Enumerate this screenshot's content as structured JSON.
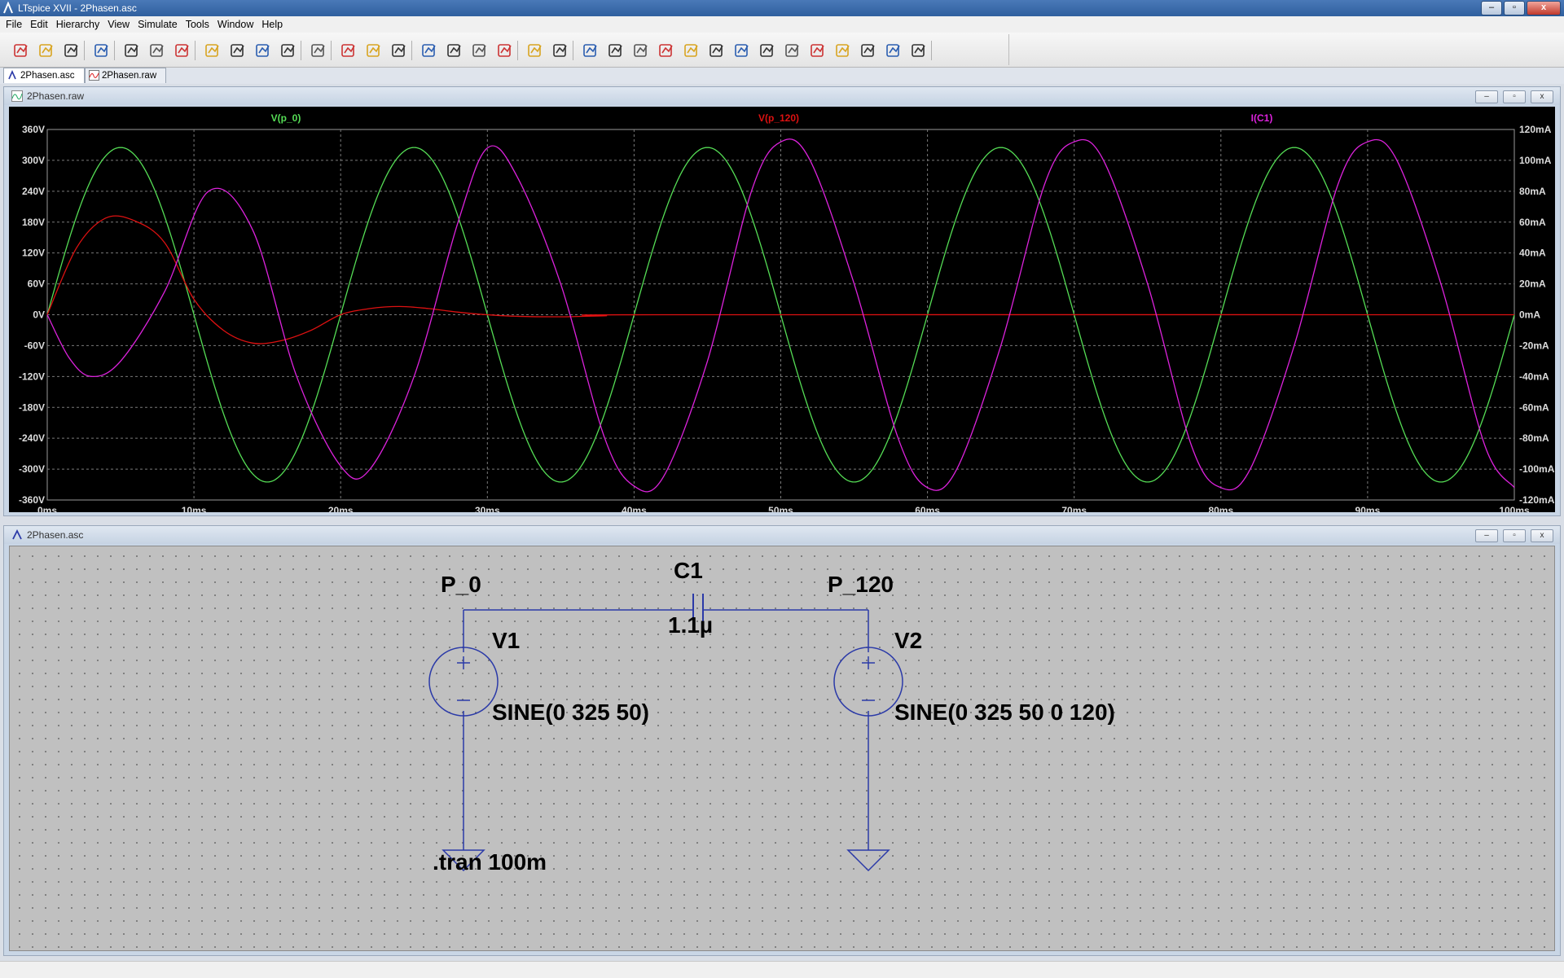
{
  "window": {
    "title": "LTspice XVII - 2Phasen.asc",
    "minimize": "–",
    "maximize": "▫",
    "close": "x"
  },
  "menu": [
    "File",
    "Edit",
    "Hierarchy",
    "View",
    "Simulate",
    "Tools",
    "Window",
    "Help"
  ],
  "toolbar_icons": [
    "new-schematic-icon",
    "open-icon",
    "save-icon",
    "control-panel-icon",
    "run-icon",
    "halt-icon",
    "pan-icon",
    "zoom-in-icon",
    "zoom-area-icon",
    "zoom-out-icon",
    "zoom-fit-icon",
    "autorange-icon",
    "delete-trace-icon",
    "tile-horizontal-icon",
    "tile-vertical-icon",
    "cascade-icon",
    "cut-icon",
    "copy-icon",
    "paste-icon",
    "find-icon",
    "print-icon",
    "print-preview-icon",
    "draw-wire-icon",
    "ground-icon",
    "label-net-icon",
    "resistor-icon",
    "capacitor-icon",
    "inductor-icon",
    "diode-icon",
    "component-icon",
    "move-icon",
    "drag-icon",
    "undo-icon",
    "redo-icon",
    "rotate-icon",
    "mirror-icon",
    "text-icon",
    "spice-directive-icon"
  ],
  "tabs": [
    {
      "label": "2Phasen.asc",
      "active": true,
      "icon": "schematic-icon"
    },
    {
      "label": "2Phasen.raw",
      "active": false,
      "icon": "waveform-icon"
    }
  ],
  "plot_window": {
    "title": "2Phasen.raw"
  },
  "schematic_window": {
    "title": "2Phasen.asc"
  },
  "chart_data": {
    "type": "line",
    "x_label": "",
    "x_range": [
      0,
      100
    ],
    "x_unit": "ms",
    "x_ticks": [
      "0ms",
      "10ms",
      "20ms",
      "30ms",
      "40ms",
      "50ms",
      "60ms",
      "70ms",
      "80ms",
      "90ms",
      "100ms"
    ],
    "y_left_ticks": [
      "360V",
      "300V",
      "240V",
      "180V",
      "120V",
      "60V",
      "0V",
      "-60V",
      "-120V",
      "-180V",
      "-240V",
      "-300V",
      "-360V"
    ],
    "y_left_range": [
      -360,
      360
    ],
    "y_right_ticks": [
      "120mA",
      "100mA",
      "80mA",
      "60mA",
      "40mA",
      "20mA",
      "0mA",
      "-20mA",
      "-40mA",
      "-60mA",
      "-80mA",
      "-100mA",
      "-120mA"
    ],
    "y_right_range": [
      -120,
      120
    ],
    "grid": true,
    "background": "#000000",
    "series": [
      {
        "name": "V(p_0)",
        "color": "#55dd55",
        "axis": "left",
        "shape": "sine",
        "amplitude_V": 325,
        "frequency_Hz": 50,
        "phase_deg": 0
      },
      {
        "name": "V(p_120)",
        "color": "#dd1111",
        "axis": "left",
        "shape": "damped",
        "points_ms_V": [
          [
            0,
            0
          ],
          [
            2,
            130
          ],
          [
            4,
            188
          ],
          [
            6,
            182
          ],
          [
            8,
            140
          ],
          [
            10,
            30
          ],
          [
            12,
            -30
          ],
          [
            14,
            -55
          ],
          [
            16,
            -50
          ],
          [
            18,
            -30
          ],
          [
            20,
            0
          ],
          [
            22,
            12
          ],
          [
            24,
            16
          ],
          [
            26,
            12
          ],
          [
            28,
            5
          ],
          [
            30,
            0
          ],
          [
            32,
            -3
          ],
          [
            35,
            -4
          ],
          [
            38,
            -2
          ],
          [
            42,
            0
          ],
          [
            100,
            0
          ]
        ]
      },
      {
        "name": "I(C1)",
        "color": "#dd22dd",
        "axis": "right",
        "shape": "transient-sine",
        "points_ms_mA": [
          [
            0,
            0
          ],
          [
            1.5,
            -28
          ],
          [
            3,
            -40
          ],
          [
            5,
            -30
          ],
          [
            8,
            15
          ],
          [
            11,
            80
          ],
          [
            14,
            55
          ],
          [
            17,
            -40
          ],
          [
            20,
            -98
          ],
          [
            22,
            -100
          ],
          [
            25,
            -40
          ],
          [
            28,
            60
          ],
          [
            30,
            108
          ],
          [
            32,
            90
          ],
          [
            35,
            20
          ],
          [
            38,
            -80
          ],
          [
            40,
            -111
          ],
          [
            42,
            -105
          ],
          [
            45,
            -30
          ],
          [
            48,
            80
          ],
          [
            50,
            112
          ],
          [
            52,
            100
          ],
          [
            55,
            20
          ],
          [
            58,
            -80
          ],
          [
            60,
            -112
          ],
          [
            62,
            -100
          ],
          [
            65,
            -20
          ],
          [
            68,
            85
          ],
          [
            70,
            112
          ],
          [
            72,
            100
          ],
          [
            75,
            20
          ],
          [
            78,
            -85
          ],
          [
            80,
            -112
          ],
          [
            82,
            -100
          ],
          [
            85,
            -20
          ],
          [
            88,
            85
          ],
          [
            90,
            112
          ],
          [
            92,
            100
          ],
          [
            95,
            20
          ],
          [
            98,
            -85
          ],
          [
            100,
            -112
          ]
        ]
      }
    ]
  },
  "schematic": {
    "labels": {
      "p0": "P_0",
      "p120": "P_120",
      "c1_name": "C1",
      "c1_value": "1.1µ",
      "v1_name": "V1",
      "v1_value": "SINE(0 325 50)",
      "v2_name": "V2",
      "v2_value": "SINE(0 325 50 0 120)",
      "directive": ".tran 100m"
    },
    "wire_color": "#2b3aa8"
  }
}
